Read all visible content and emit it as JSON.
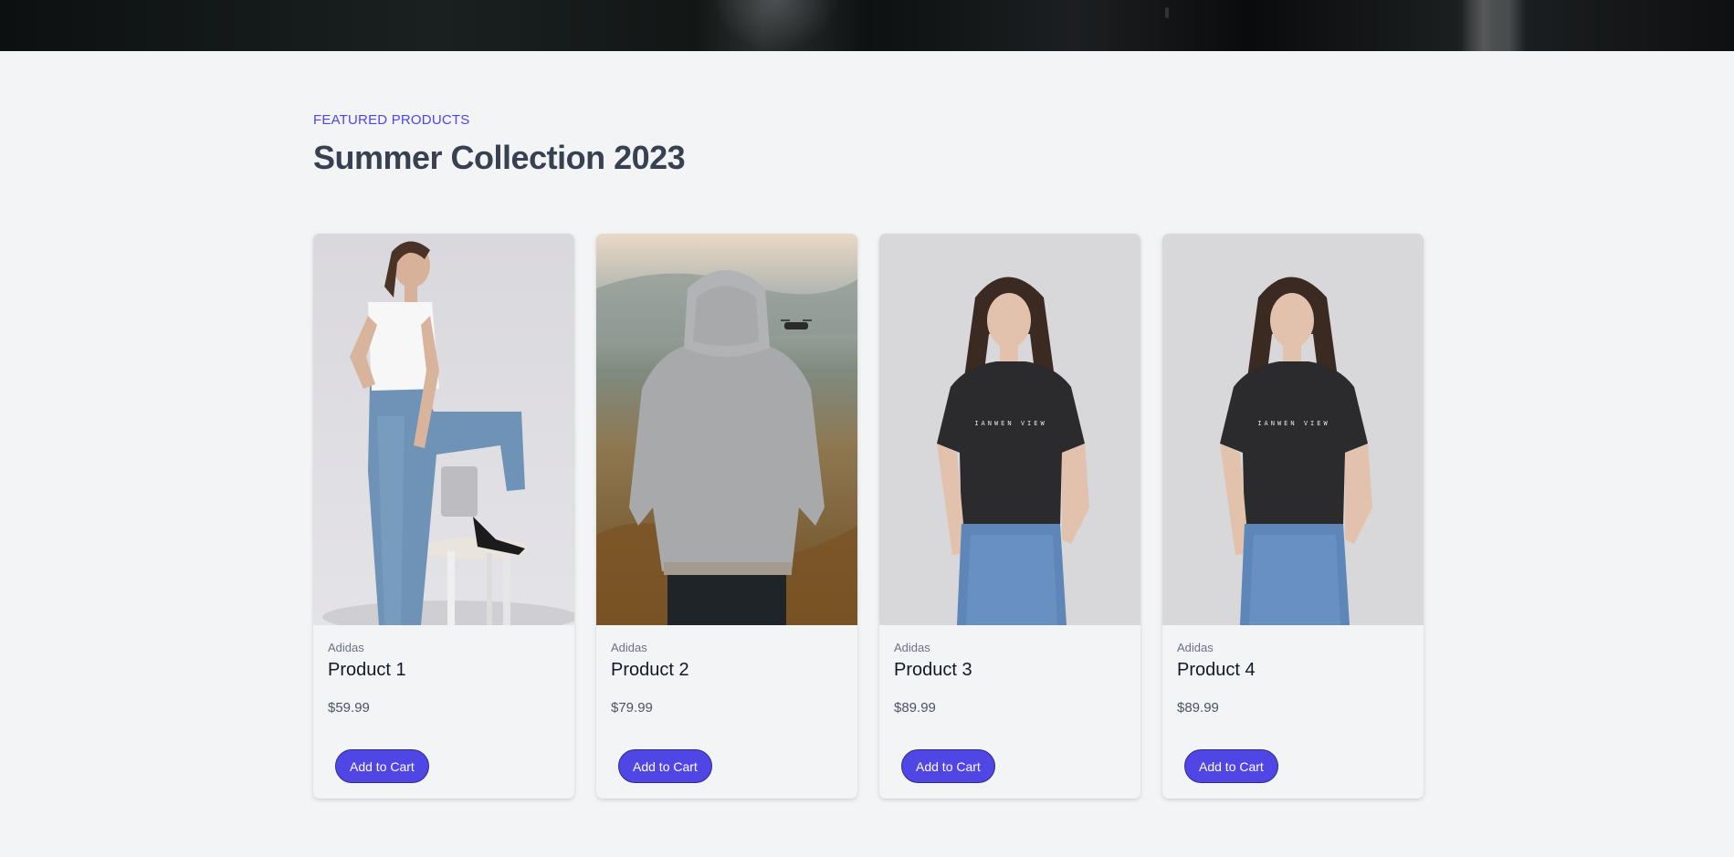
{
  "featured": {
    "eyebrow": "FEATURED PRODUCTS",
    "title": "Summer Collection 2023"
  },
  "products": [
    {
      "brand": "Adidas",
      "name": "Product 1",
      "price": "$59.99",
      "cta": "Add to Cart",
      "image": "woman-white-top-jeans-chair"
    },
    {
      "brand": "Adidas",
      "name": "Product 2",
      "price": "$79.99",
      "cta": "Add to Cart",
      "image": "grey-hoodie-drone-landscape"
    },
    {
      "brand": "Adidas",
      "name": "Product 3",
      "price": "$89.99",
      "cta": "Add to Cart",
      "image": "woman-black-tee-jeans"
    },
    {
      "brand": "Adidas",
      "name": "Product 4",
      "price": "$89.99",
      "cta": "Add to Cart",
      "image": "woman-black-tee-jeans"
    }
  ],
  "colors": {
    "accent": "#4f46e5",
    "heading": "#374151",
    "background": "#f3f4f6"
  }
}
